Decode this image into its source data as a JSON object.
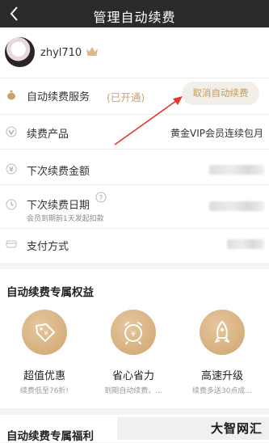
{
  "header": {
    "title": "管理自动续费"
  },
  "user": {
    "name": "zhyl710"
  },
  "rows": {
    "service_label": "自动续费服务",
    "service_status": "(已开通)",
    "cancel_label": "取消自动续费",
    "product_label": "续费产品",
    "product_value": "黄金VIP会员连续包月",
    "amount_label": "下次续费金额",
    "date_label": "下次续费日期",
    "date_hint": "会员到期前1天发起扣款",
    "payment_label": "支付方式"
  },
  "benefits": {
    "title": "自动续费专属权益",
    "items": [
      {
        "name": "超值优惠",
        "desc": "续费低至76折!",
        "icon": "discount-tag-icon"
      },
      {
        "name": "省心省力",
        "desc": "到期自动续费，...",
        "icon": "alarm-clock-icon"
      },
      {
        "name": "高速升级",
        "desc": "续费多送30点成...",
        "icon": "rocket-icon"
      }
    ]
  },
  "welfare": {
    "title": "自动续费专属福利"
  },
  "watermark": "大智网汇",
  "colors": {
    "header_bg": "#2b2b2b",
    "accent_gold": "#c8a26b",
    "button_bg": "#f2efea",
    "annotation_arrow": "#e0392b"
  }
}
